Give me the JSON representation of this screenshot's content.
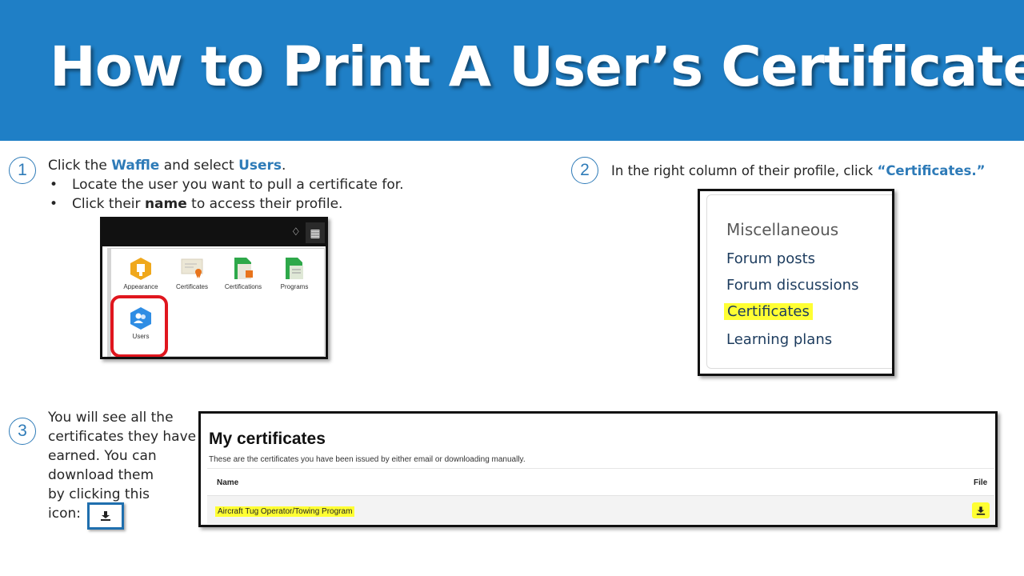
{
  "title": "How to Print A User’s Certificate",
  "step1": {
    "number": "1",
    "intro_prefix": "Click the",
    "waffle": "Waffle",
    "intro_mid": "and select",
    "users": "Users",
    "intro_end": ".",
    "bullets": [
      {
        "text": "Locate the user you want to pull a certificate for."
      },
      {
        "prefix": "Click their",
        "bold": "name",
        "suffix": "to access their profile."
      }
    ],
    "screenshot": {
      "tiles": [
        "Appearance",
        "Certificates",
        "Certifications",
        "Programs",
        "Users"
      ]
    }
  },
  "step2": {
    "number": "2",
    "text": "In the right column of their profile, click",
    "highlight": "“Certificates.”",
    "screenshot": {
      "heading": "Miscellaneous",
      "links": [
        "Forum posts",
        "Forum discussions",
        "Certificates",
        "Learning plans"
      ],
      "highlighted": "Certificates"
    }
  },
  "step3": {
    "number": "3",
    "lines": [
      "You will see all the",
      "certificates they have",
      "earned. You can",
      "download them",
      "by clicking this",
      "icon:"
    ],
    "screenshot": {
      "heading": "My certificates",
      "description": "These are the certificates you have been issued by either email or downloading manually.",
      "columns": [
        "Name",
        "File"
      ],
      "rows": [
        {
          "name": "Aircraft Tug Operator/Towing Program"
        }
      ]
    }
  },
  "colors": {
    "banner": "#1f7fc6",
    "accent": "#2e7bb8",
    "highlight": "#ffff33",
    "ring": "#e0161e"
  }
}
